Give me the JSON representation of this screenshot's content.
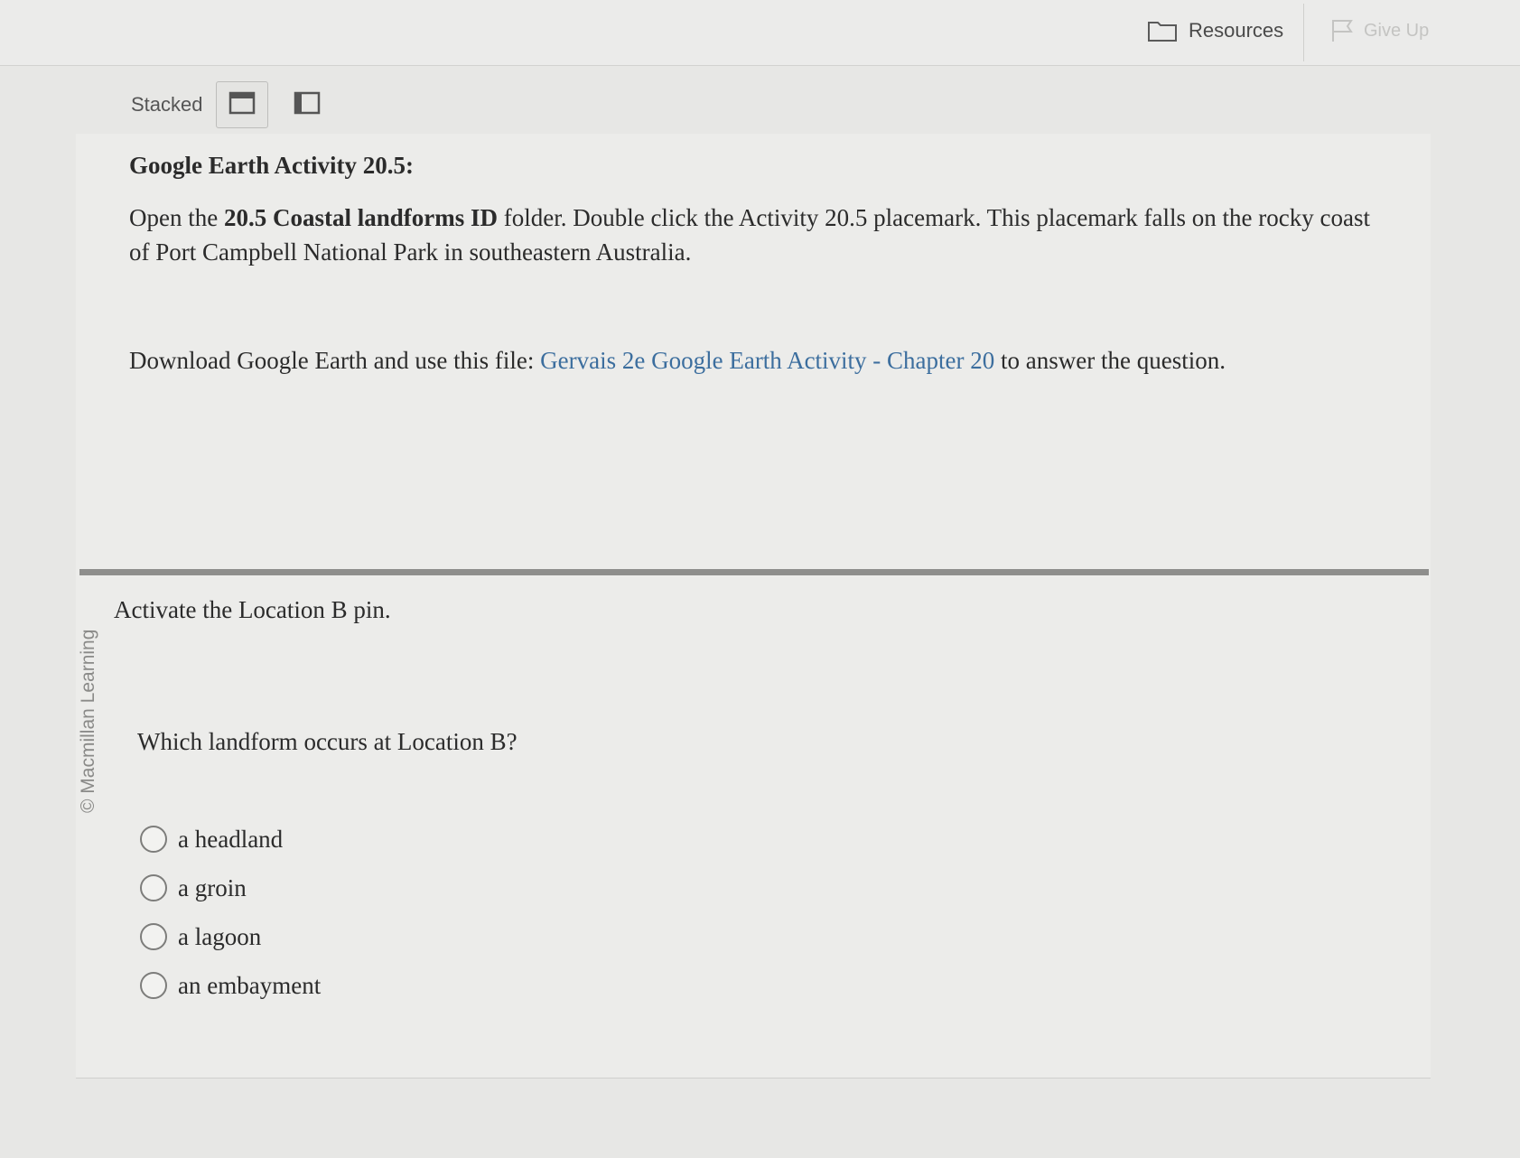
{
  "toolbar": {
    "resources_label": "Resources",
    "give_up_label": "Give Up"
  },
  "view": {
    "label": "Stacked",
    "options": [
      "stacked-view",
      "side-by-side-view"
    ]
  },
  "activity": {
    "title": "Google Earth Activity 20.5:",
    "intro_part1": "Open the ",
    "intro_bold": "20.5 Coastal landforms ID",
    "intro_part2": " folder. Double click the Activity 20.5 placemark. This placemark falls on the rocky coast of Port Campbell National Park in southeastern Australia.",
    "download_prefix": "Download Google Earth and use this file: ",
    "download_link": "Gervais 2e Google Earth Activity - Chapter 20",
    "download_suffix": " to answer the question."
  },
  "watermark": "© Macmillan Learning",
  "question": {
    "instruction": "Activate the Location B pin.",
    "prompt": "Which landform occurs at Location B?",
    "options": [
      {
        "label": "a headland"
      },
      {
        "label": "a groin"
      },
      {
        "label": "a lagoon"
      },
      {
        "label": "an embayment"
      }
    ]
  },
  "colors": {
    "link": "#3c6e9e",
    "divider": "#8e8e8c"
  }
}
